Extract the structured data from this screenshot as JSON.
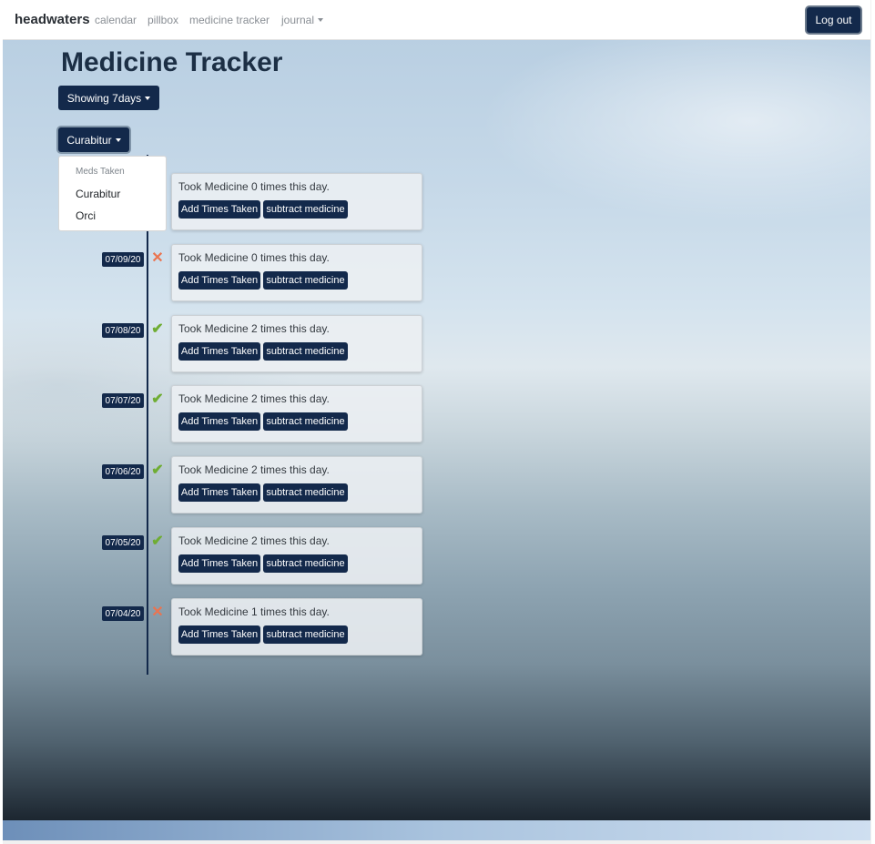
{
  "nav": {
    "brand": "headwaters",
    "links": [
      "calendar",
      "pillbox",
      "medicine tracker"
    ],
    "journal": "journal",
    "logout": "Log out"
  },
  "page": {
    "title": "Medicine Tracker",
    "range_button": "Showing 7days",
    "med_button": "Curabitur"
  },
  "menu": {
    "header": "Meds Taken",
    "items": [
      "Curabitur",
      "Orci"
    ]
  },
  "card_buttons": {
    "add": "Add Times Taken",
    "subtract": "subtract medicine"
  },
  "days": [
    {
      "date": "",
      "status": "",
      "text": "Took Medicine 0 times this day."
    },
    {
      "date": "07/09/20",
      "status": "missed",
      "status_icon": "cross-icon",
      "text": "Took Medicine 0 times this day."
    },
    {
      "date": "07/08/20",
      "status": "taken",
      "status_icon": "check-icon",
      "text": "Took Medicine 2 times this day."
    },
    {
      "date": "07/07/20",
      "status": "taken",
      "status_icon": "check-icon",
      "text": "Took Medicine 2 times this day."
    },
    {
      "date": "07/06/20",
      "status": "taken",
      "status_icon": "check-icon",
      "text": "Took Medicine 2 times this day."
    },
    {
      "date": "07/05/20",
      "status": "taken",
      "status_icon": "check-icon",
      "text": "Took Medicine 2 times this day."
    },
    {
      "date": "07/04/20",
      "status": "missed",
      "status_icon": "cross-icon",
      "text": "Took Medicine 1 times this day."
    }
  ],
  "colors": {
    "primary": "#13294b",
    "taken": "#6fad33",
    "missed": "#ea7450"
  }
}
